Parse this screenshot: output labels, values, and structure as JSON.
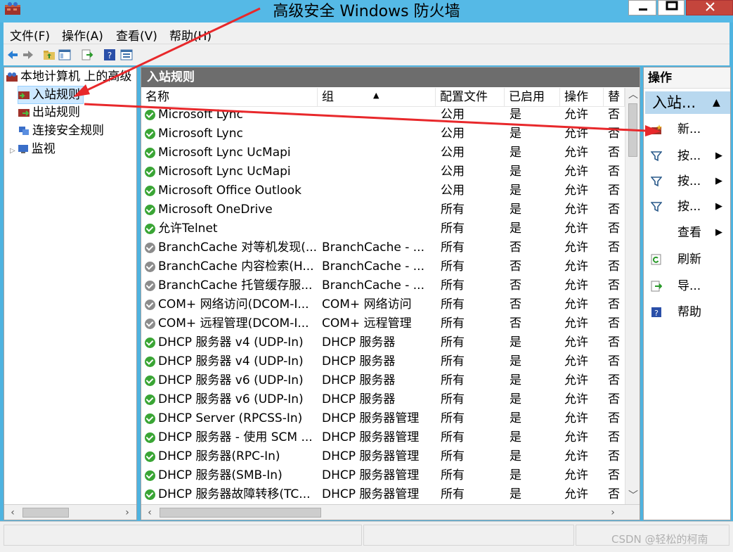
{
  "window": {
    "title": "高级安全 Windows 防火墙"
  },
  "menu": [
    {
      "label": "文件(F)"
    },
    {
      "label": "操作(A)"
    },
    {
      "label": "查看(V)"
    },
    {
      "label": "帮助(H)"
    }
  ],
  "toolbar": [
    "back-icon",
    "forward-icon",
    "up-folder-icon",
    "show-hide-tree-icon",
    "export-list-icon",
    "help-icon",
    "properties-icon"
  ],
  "tree": {
    "root": "本地计算机 上的高级",
    "items": [
      {
        "label": "入站规则"
      },
      {
        "label": "出站规则"
      },
      {
        "label": "连接安全规则"
      },
      {
        "label": "监视"
      }
    ]
  },
  "center": {
    "title": "入站规则",
    "columns": [
      "名称",
      "组",
      "配置文件",
      "已启用",
      "操作",
      "替"
    ],
    "rows": [
      {
        "name": "Microsoft Lync",
        "group": "",
        "profile": "公用",
        "enabled": "是",
        "action": "允许",
        "override": "否",
        "status": "on"
      },
      {
        "name": "Microsoft Lync",
        "group": "",
        "profile": "公用",
        "enabled": "是",
        "action": "允许",
        "override": "否",
        "status": "on"
      },
      {
        "name": "Microsoft Lync UcMapi",
        "group": "",
        "profile": "公用",
        "enabled": "是",
        "action": "允许",
        "override": "否",
        "status": "on"
      },
      {
        "name": "Microsoft Lync UcMapi",
        "group": "",
        "profile": "公用",
        "enabled": "是",
        "action": "允许",
        "override": "否",
        "status": "on"
      },
      {
        "name": "Microsoft Office Outlook",
        "group": "",
        "profile": "公用",
        "enabled": "是",
        "action": "允许",
        "override": "否",
        "status": "on"
      },
      {
        "name": "Microsoft OneDrive",
        "group": "",
        "profile": "所有",
        "enabled": "是",
        "action": "允许",
        "override": "否",
        "status": "on"
      },
      {
        "name": "允许Telnet",
        "group": "",
        "profile": "所有",
        "enabled": "是",
        "action": "允许",
        "override": "否",
        "status": "on"
      },
      {
        "name": "BranchCache 对等机发现(...",
        "group": "BranchCache - ...",
        "profile": "所有",
        "enabled": "否",
        "action": "允许",
        "override": "否",
        "status": "off"
      },
      {
        "name": "BranchCache 内容检索(H...",
        "group": "BranchCache - ...",
        "profile": "所有",
        "enabled": "否",
        "action": "允许",
        "override": "否",
        "status": "off"
      },
      {
        "name": "BranchCache 托管缓存服...",
        "group": "BranchCache - ...",
        "profile": "所有",
        "enabled": "否",
        "action": "允许",
        "override": "否",
        "status": "off"
      },
      {
        "name": "COM+ 网络访问(DCOM-I...",
        "group": "COM+ 网络访问",
        "profile": "所有",
        "enabled": "否",
        "action": "允许",
        "override": "否",
        "status": "off"
      },
      {
        "name": "COM+ 远程管理(DCOM-I...",
        "group": "COM+ 远程管理",
        "profile": "所有",
        "enabled": "否",
        "action": "允许",
        "override": "否",
        "status": "off"
      },
      {
        "name": "DHCP 服务器 v4 (UDP-In)",
        "group": "DHCP 服务器",
        "profile": "所有",
        "enabled": "是",
        "action": "允许",
        "override": "否",
        "status": "on"
      },
      {
        "name": "DHCP 服务器 v4 (UDP-In)",
        "group": "DHCP 服务器",
        "profile": "所有",
        "enabled": "是",
        "action": "允许",
        "override": "否",
        "status": "on"
      },
      {
        "name": "DHCP 服务器 v6 (UDP-In)",
        "group": "DHCP 服务器",
        "profile": "所有",
        "enabled": "是",
        "action": "允许",
        "override": "否",
        "status": "on"
      },
      {
        "name": "DHCP 服务器 v6 (UDP-In)",
        "group": "DHCP 服务器",
        "profile": "所有",
        "enabled": "是",
        "action": "允许",
        "override": "否",
        "status": "on"
      },
      {
        "name": "DHCP Server (RPCSS-In)",
        "group": "DHCP 服务器管理",
        "profile": "所有",
        "enabled": "是",
        "action": "允许",
        "override": "否",
        "status": "on"
      },
      {
        "name": "DHCP 服务器 - 使用 SCM ...",
        "group": "DHCP 服务器管理",
        "profile": "所有",
        "enabled": "是",
        "action": "允许",
        "override": "否",
        "status": "on"
      },
      {
        "name": "DHCP 服务器(RPC-In)",
        "group": "DHCP 服务器管理",
        "profile": "所有",
        "enabled": "是",
        "action": "允许",
        "override": "否",
        "status": "on"
      },
      {
        "name": "DHCP 服务器(SMB-In)",
        "group": "DHCP 服务器管理",
        "profile": "所有",
        "enabled": "是",
        "action": "允许",
        "override": "否",
        "status": "on"
      },
      {
        "name": "DHCP 服务器故障转移(TC...",
        "group": "DHCP 服务器管理",
        "profile": "所有",
        "enabled": "是",
        "action": "允许",
        "override": "否",
        "status": "on"
      }
    ]
  },
  "actions": {
    "title": "操作",
    "group_label": "入站...",
    "items": [
      {
        "label": "新...",
        "icon": "new-rule-icon",
        "submenu": false
      },
      {
        "label": "按...",
        "icon": "filter-icon",
        "submenu": true
      },
      {
        "label": "按...",
        "icon": "filter-icon",
        "submenu": true
      },
      {
        "label": "按...",
        "icon": "filter-icon",
        "submenu": true
      },
      {
        "label": "查看",
        "icon": "",
        "submenu": true
      },
      {
        "label": "刷新",
        "icon": "refresh-icon",
        "submenu": false
      },
      {
        "label": "导...",
        "icon": "export-icon",
        "submenu": false
      },
      {
        "label": "帮助",
        "icon": "help-icon",
        "submenu": false
      }
    ]
  },
  "watermark": "CSDN @轻松的柯南",
  "colors": {
    "titlebar": "#55b9e6",
    "selected": "#cde8ff",
    "header": "#6d6d6d",
    "enabled_icon": "#3aa535",
    "disabled_icon": "#8c8c8c",
    "annotation_arrow": "#e8282b"
  }
}
